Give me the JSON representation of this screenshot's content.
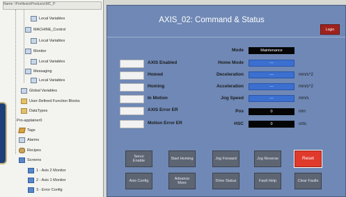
{
  "project_tree": {
    "path": "Name: \\ProfilesiotProducts\\MC_P",
    "items": [
      {
        "label": "Local Variables"
      },
      {
        "label": "MACHINE_Control"
      },
      {
        "label": "Local Variables"
      },
      {
        "label": "Monitor"
      },
      {
        "label": "Local Variables"
      },
      {
        "label": "Messaging"
      },
      {
        "label": "Local Variables"
      },
      {
        "label": "Global Variables"
      },
      {
        "label": "User-Defined Function Blocks"
      },
      {
        "label": "DataTypes"
      },
      {
        "label": "Pro-apptainer0"
      },
      {
        "label": "Tags"
      },
      {
        "label": "Alarms"
      },
      {
        "label": "Recipes"
      },
      {
        "label": "Screens"
      },
      {
        "label": "1 - Axis 2 Monitor"
      },
      {
        "label": "2 - Axis 1 Monitor"
      },
      {
        "label": "3 - Error Config"
      }
    ]
  },
  "hmi": {
    "title": "AXIS_02: Command & Status",
    "login_label": "Login",
    "status_lamps": [
      {
        "label": "AXIS Enabled"
      },
      {
        "label": "Homed"
      },
      {
        "label": "Homing"
      },
      {
        "label": "In Motion"
      },
      {
        "label": "AXIS Error ER"
      },
      {
        "label": "Motion Error ER"
      }
    ],
    "fields": [
      {
        "label": "Mode",
        "value": "Maintenance",
        "unit": "",
        "style": "black"
      },
      {
        "label": "Home Mode",
        "value": "---",
        "unit": "",
        "style": "blue"
      },
      {
        "label": "Deceleration",
        "value": "---",
        "unit": "mm/s^2",
        "style": "blue"
      },
      {
        "label": "Acceleration",
        "value": "---",
        "unit": "mm/s^2",
        "style": "blue"
      },
      {
        "label": "Jog Speed",
        "value": "---",
        "unit": "mm/s",
        "style": "blue"
      },
      {
        "label": "Pos",
        "value": "0",
        "unit": "mm",
        "style": "black"
      },
      {
        "label": "HSC",
        "value": "0",
        "unit": "cnts",
        "style": "black"
      }
    ],
    "buttons_row1": [
      {
        "label": "Servo Enable"
      },
      {
        "label": "Start Homing"
      },
      {
        "label": "Jog Forward"
      },
      {
        "label": "Jog Reverse"
      },
      {
        "label": "Reset"
      }
    ],
    "buttons_row2": [
      {
        "label": "Axis Config"
      },
      {
        "label": "Advance More"
      },
      {
        "label": "Drive Status"
      },
      {
        "label": "Fault Help"
      },
      {
        "label": "Clear Faults"
      }
    ],
    "colors": {
      "panel": "#6f88b5",
      "reset": "#e03a2c",
      "login": "#a0221c",
      "field_blue": "#3b6fd0"
    }
  }
}
